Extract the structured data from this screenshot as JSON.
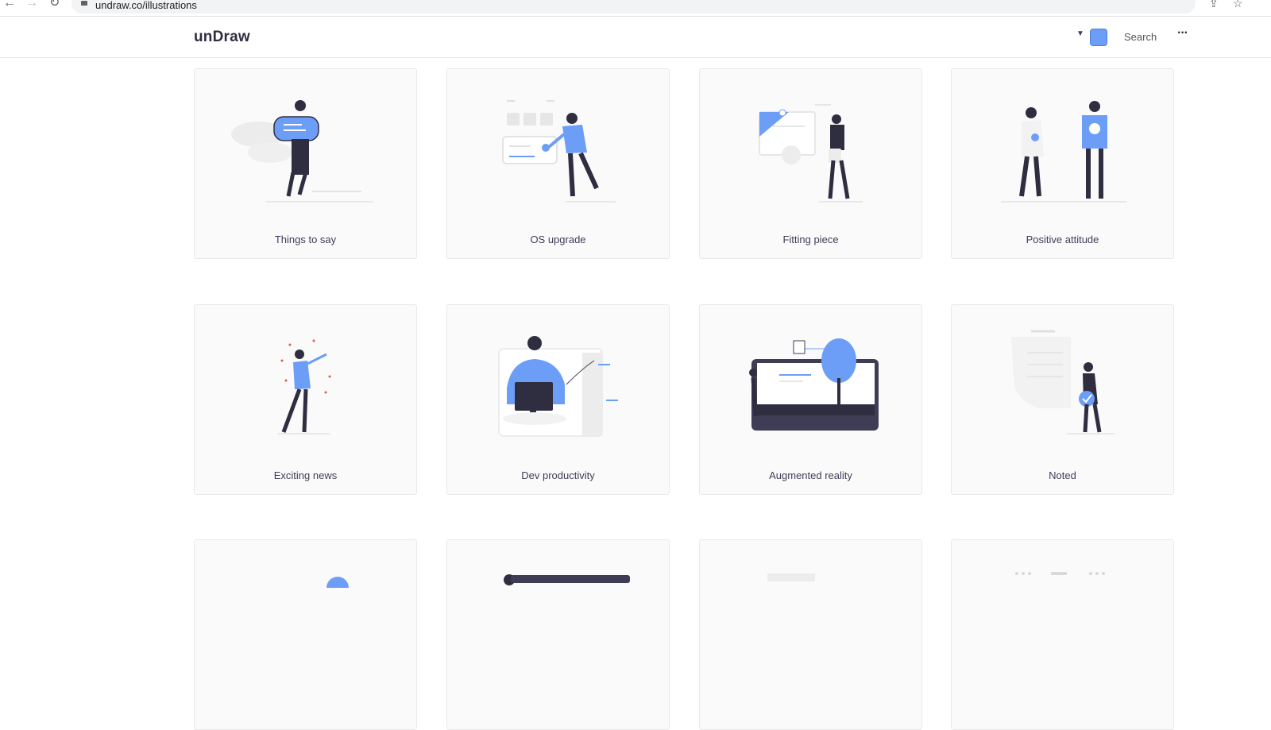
{
  "browser": {
    "url": "undraw.co/illustrations",
    "back_icon": "arrow-left-icon",
    "forward_icon": "arrow-right-icon",
    "reload_icon": "reload-icon",
    "lock_icon": "lock-icon",
    "share_icon": "share-icon",
    "bookmark_icon": "star-icon"
  },
  "header": {
    "logo": "unDraw",
    "accent_color": "#6c9ef8",
    "search_label": "Search",
    "more_icon": "more-horizontal-icon"
  },
  "illustrations": [
    {
      "title": "Things to say"
    },
    {
      "title": "OS upgrade"
    },
    {
      "title": "Fitting piece"
    },
    {
      "title": "Positive attitude"
    },
    {
      "title": "Exciting news"
    },
    {
      "title": "Dev productivity"
    },
    {
      "title": "Augmented reality"
    },
    {
      "title": "Noted"
    }
  ],
  "colors": {
    "accent": "#6c9ef8",
    "dark": "#2f2e41",
    "light": "#e6e6e6"
  }
}
